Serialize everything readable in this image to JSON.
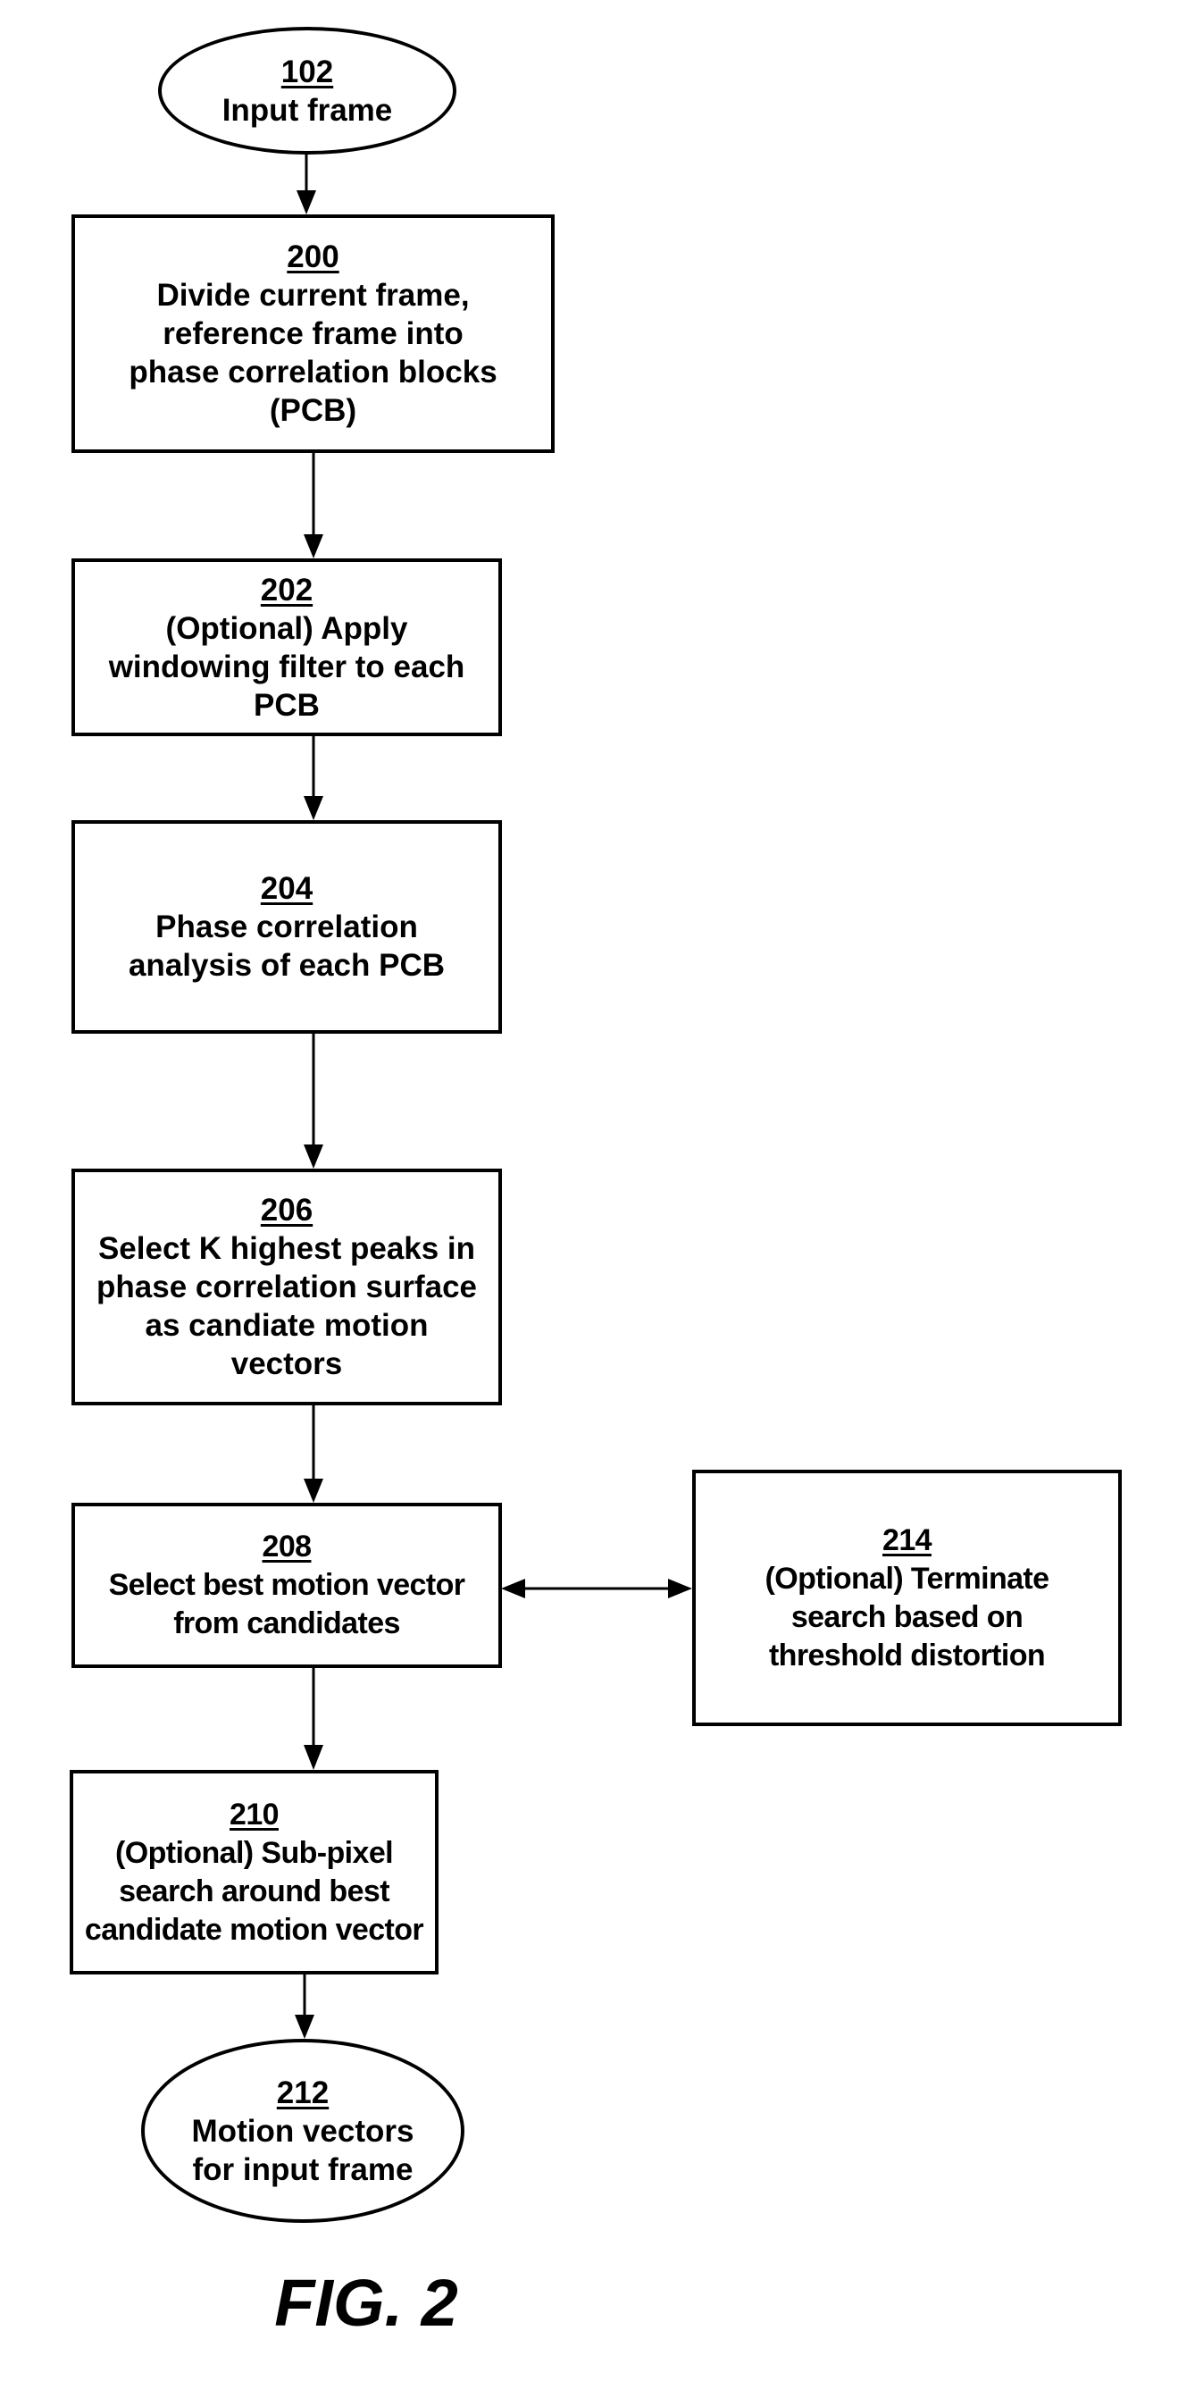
{
  "figure_label": "FIG. 2",
  "nodes": [
    {
      "id": "102",
      "shape": "oval",
      "label": "Input frame"
    },
    {
      "id": "200",
      "shape": "box",
      "label": "Divide current frame,\nreference frame into\nphase correlation blocks\n(PCB)"
    },
    {
      "id": "202",
      "shape": "box",
      "label": "(Optional) Apply\nwindowing filter to each\nPCB"
    },
    {
      "id": "204",
      "shape": "box",
      "label": "Phase correlation\nanalysis of each PCB"
    },
    {
      "id": "206",
      "shape": "box",
      "label": "Select K highest peaks in\nphase correlation surface\nas candiate motion\nvectors"
    },
    {
      "id": "208",
      "shape": "box",
      "label": "Select best motion vector\nfrom candidates"
    },
    {
      "id": "214",
      "shape": "box",
      "label": "(Optional) Terminate\nsearch based on\nthreshold distortion"
    },
    {
      "id": "210",
      "shape": "box",
      "label": "(Optional) Sub-pixel\nsearch around best\ncandidate motion vector"
    },
    {
      "id": "212",
      "shape": "oval",
      "label": "Motion vectors\nfor input frame"
    }
  ],
  "edges": [
    {
      "from": "102",
      "to": "200",
      "direction": "forward"
    },
    {
      "from": "200",
      "to": "202",
      "direction": "forward"
    },
    {
      "from": "202",
      "to": "204",
      "direction": "forward"
    },
    {
      "from": "204",
      "to": "206",
      "direction": "forward"
    },
    {
      "from": "206",
      "to": "208",
      "direction": "forward"
    },
    {
      "from": "208",
      "to": "214",
      "direction": "bidirectional"
    },
    {
      "from": "208",
      "to": "210",
      "direction": "forward"
    },
    {
      "from": "210",
      "to": "212",
      "direction": "forward"
    }
  ]
}
